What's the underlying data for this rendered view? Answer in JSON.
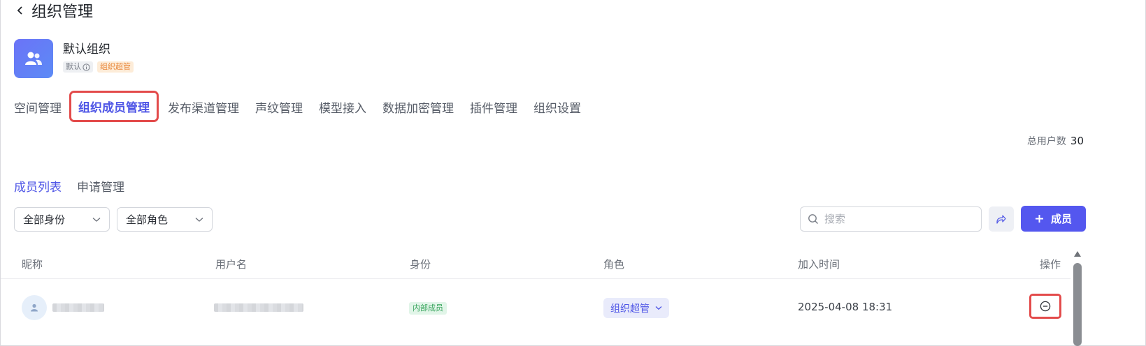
{
  "header": {
    "title": "组织管理"
  },
  "org": {
    "name": "默认组织",
    "badge_default": "默认",
    "badge_admin": "组织超管"
  },
  "tabs": [
    {
      "label": "空间管理"
    },
    {
      "label": "组织成员管理",
      "active": true
    },
    {
      "label": "发布渠道管理"
    },
    {
      "label": "声纹管理"
    },
    {
      "label": "模型接入"
    },
    {
      "label": "数据加密管理"
    },
    {
      "label": "插件管理"
    },
    {
      "label": "组织设置"
    }
  ],
  "summary": {
    "label": "总用户数",
    "count": "30"
  },
  "subtabs": [
    {
      "label": "成员列表",
      "active": true
    },
    {
      "label": "申请管理"
    }
  ],
  "filters": {
    "identity": "全部身份",
    "role": "全部角色"
  },
  "search": {
    "placeholder": "搜索",
    "value": ""
  },
  "actions": {
    "add_member": "成员"
  },
  "table": {
    "columns": [
      "昵称",
      "用户名",
      "身份",
      "角色",
      "加入时间",
      "操作"
    ],
    "rows": [
      {
        "identity": "内部成员",
        "role": "组织超管",
        "join_time": "2025-04-08 18:31"
      }
    ]
  },
  "colors": {
    "accent": "#5457ef",
    "highlight": "#e34b4b",
    "tag_green": "#3aa55e",
    "tag_orange": "#e8873a"
  }
}
